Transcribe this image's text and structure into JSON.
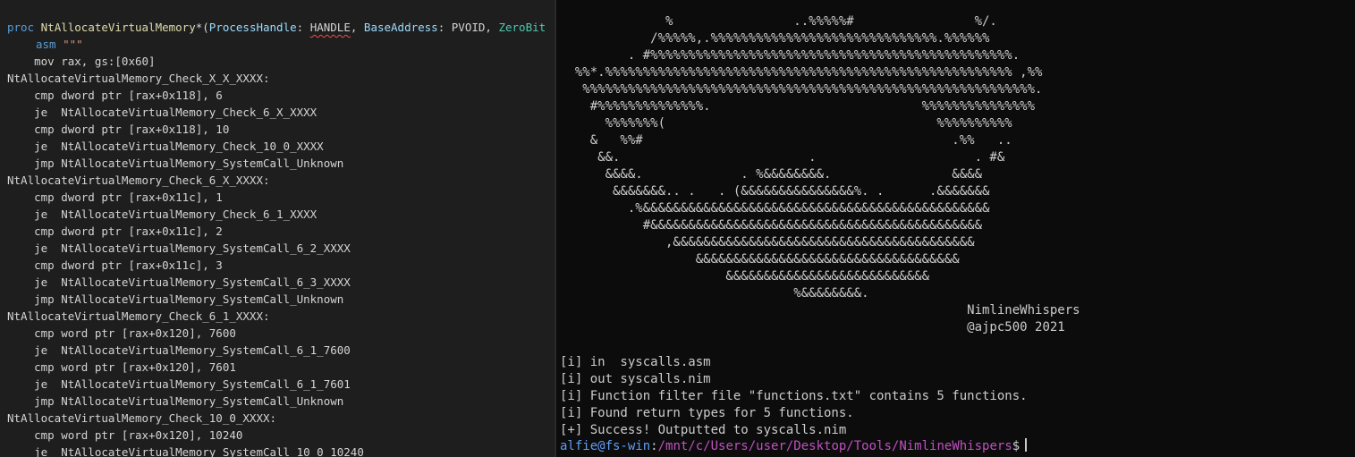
{
  "editor": {
    "header": {
      "proc": "proc",
      "name": "NtAllocateVirtualMemory",
      "star": "*",
      "open": "(",
      "p1": "ProcessHandle",
      "c1": ": ",
      "t1": "HANDLE",
      "sep1": ", ",
      "p2": "BaseAddress",
      "c2": ": ",
      "t2": "PVOID",
      "sep2": ", ",
      "p3": "ZeroBit"
    },
    "asm_line": {
      "kw": "asm",
      "str": " \"\"\""
    },
    "lines": [
      "    mov rax, gs:[0x60]",
      "NtAllocateVirtualMemory_Check_X_X_XXXX:",
      "    cmp dword ptr [rax+0x118], 6",
      "    je  NtAllocateVirtualMemory_Check_6_X_XXXX",
      "    cmp dword ptr [rax+0x118], 10",
      "    je  NtAllocateVirtualMemory_Check_10_0_XXXX",
      "    jmp NtAllocateVirtualMemory_SystemCall_Unknown",
      "NtAllocateVirtualMemory_Check_6_X_XXXX:",
      "    cmp dword ptr [rax+0x11c], 1",
      "    je  NtAllocateVirtualMemory_Check_6_1_XXXX",
      "    cmp dword ptr [rax+0x11c], 2",
      "    je  NtAllocateVirtualMemory_SystemCall_6_2_XXXX",
      "    cmp dword ptr [rax+0x11c], 3",
      "    je  NtAllocateVirtualMemory_SystemCall_6_3_XXXX",
      "    jmp NtAllocateVirtualMemory_SystemCall_Unknown",
      "NtAllocateVirtualMemory_Check_6_1_XXXX:",
      "    cmp word ptr [rax+0x120], 7600",
      "    je  NtAllocateVirtualMemory_SystemCall_6_1_7600",
      "    cmp word ptr [rax+0x120], 7601",
      "    je  NtAllocateVirtualMemory_SystemCall_6_1_7601",
      "    jmp NtAllocateVirtualMemory_SystemCall_Unknown",
      "NtAllocateVirtualMemory_Check_10_0_XXXX:",
      "    cmp word ptr [rax+0x120], 10240",
      "    je  NtAllocateVirtualMemory_SystemCall_10_0_10240"
    ]
  },
  "terminal": {
    "banner": [
      "              %                ..%%%%%#                %/.",
      "            /%%%%%,.%%%%%%%%%%%%%%%%%%%%%%%%%%%%%%.%%%%%%",
      "         . #%%%%%%%%%%%%%%%%%%%%%%%%%%%%%%%%%%%%%%%%%%%%%%%%.",
      "  %%*.%%%%%%%%%%%%%%%%%%%%%%%%%%%%%%%%%%%%%%%%%%%%%%%%%%%%%% ,%%",
      "   %%%%%%%%%%%%%%%%%%%%%%%%%%%%%%%%%%%%%%%%%%%%%%%%%%%%%%%%%%%%.",
      "    #%%%%%%%%%%%%%%.                            %%%%%%%%%%%%%%%",
      "      %%%%%%%(                                    %%%%%%%%%%",
      "    &   %%#                                         .%%   ..",
      "     &&.                         .                     . #&",
      "      &&&&.             . %&&&&&&&&.                &&&&",
      "       &&&&&&&.. .   . (&&&&&&&&&&&&&&&%. .      .&&&&&&&",
      "         .%&&&&&&&&&&&&&&&&&&&&&&&&&&&&&&&&&&&&&&&&&&&&&&",
      "           #&&&&&&&&&&&&&&&&&&&&&&&&&&&&&&&&&&&&&&&&&&&&",
      "              ,&&&&&&&&&&&&&&&&&&&&&&&&&&&&&&&&&&&&&&&&",
      "                  &&&&&&&&&&&&&&&&&&&&&&&&&&&&&&&&&&&",
      "                      &&&&&&&&&&&&&&&&&&&&&&&&&&&",
      "                               %&&&&&&&&.",
      "                                                      NimlineWhispers",
      "                                                      @ajpc500 2021"
    ],
    "output": [
      "[i] in  syscalls.asm",
      "[i] out syscalls.nim",
      "[i] Function filter file \"functions.txt\" contains 5 functions.",
      "[i] Found return types for 5 functions.",
      "[+] Success! Outputted to syscalls.nim"
    ],
    "prompt": {
      "user": "alfie@fs-win",
      "colon": ":",
      "path": "/mnt/c/Users/user/Desktop/Tools/NimlineWhispers",
      "dollar": "$"
    }
  }
}
